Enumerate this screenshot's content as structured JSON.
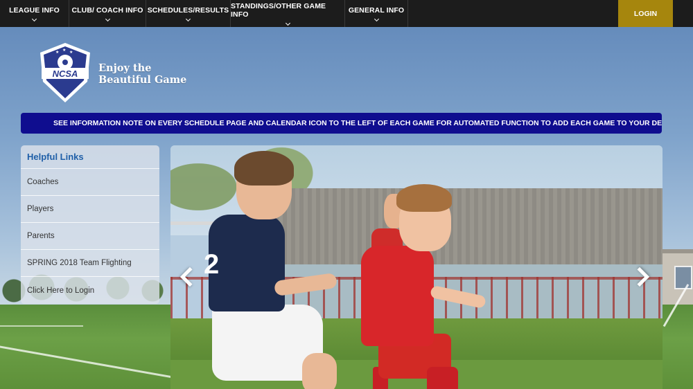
{
  "nav": {
    "items": [
      {
        "label": "LEAGUE INFO"
      },
      {
        "label": "CLUB/ COACH INFO"
      },
      {
        "label": "SCHEDULES/RESULTS"
      },
      {
        "label": "STANDINGS/OTHER GAME INFO"
      },
      {
        "label": "GENERAL INFO"
      }
    ],
    "login_label": "LOGIN",
    "login_color": "#a6860d"
  },
  "logo": {
    "abbr": "NCSA",
    "tagline_line1": "Enjoy the",
    "tagline_line2": "Beautiful Game"
  },
  "marquee": {
    "text": "SEE INFORMATION NOTE ON EVERY SCHEDULE PAGE AND CALENDAR ICON TO THE LEFT OF EACH GAME FOR AUTOMATED FUNCTION TO ADD EACH GAME TO YOUR DEVICE",
    "color": "#0f0d8f"
  },
  "helpful_links": {
    "title": "Helpful Links",
    "items": [
      {
        "label": "Coaches"
      },
      {
        "label": "Players"
      },
      {
        "label": "Parents"
      },
      {
        "label": "SPRING 2018 Team Flighting"
      },
      {
        "label": "Click Here to Login"
      }
    ]
  },
  "carousel": {
    "prev_icon": "chevron-left-icon",
    "next_icon": "chevron-right-icon",
    "player_number": "2"
  }
}
